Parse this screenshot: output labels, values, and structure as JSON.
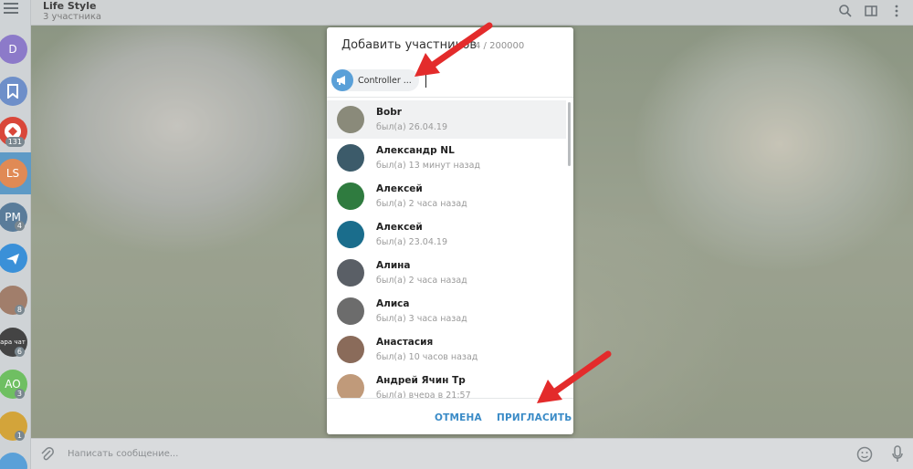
{
  "header": {
    "title": "Life Style",
    "subtitle": "3 участника"
  },
  "chats": [
    {
      "label": "D",
      "color": "#8c7ac9"
    },
    {
      "label": "",
      "color": "#6e8fc9",
      "icon": "bookmark-icon"
    },
    {
      "label": "",
      "color": "#d9473a",
      "badge": "131"
    },
    {
      "label": "LS",
      "color": "#e08a55"
    },
    {
      "label": "PM",
      "color": "#5a7c9a",
      "badge": "4"
    },
    {
      "label": "",
      "color": "#3a90d8",
      "icon": "plane-icon"
    },
    {
      "label": "",
      "color": "#a17e6b",
      "badge": "8"
    },
    {
      "label": "",
      "color": "#444444",
      "badge": "6",
      "text": "ара чат"
    },
    {
      "label": "AO",
      "color": "#6fbf62",
      "badge": "3"
    },
    {
      "label": "",
      "color": "#d3a43a",
      "badge": "1"
    }
  ],
  "modal": {
    "title": "Добавить участников",
    "count": "4 / 200000",
    "chip_label": "Controller ...",
    "contacts": [
      {
        "name": "Bobr",
        "status": "был(а) 26.04.19",
        "color": "#8a8a7a"
      },
      {
        "name": "Александр NL",
        "status": "был(а) 13 минут назад",
        "color": "#3c5b6a"
      },
      {
        "name": "Алексей",
        "status": "был(а) 2 часа назад",
        "color": "#2f7b3f"
      },
      {
        "name": "Алексей",
        "status": "был(а) 23.04.19",
        "color": "#1a6d8c"
      },
      {
        "name": "Алина",
        "status": "был(а) 2 часа назад",
        "color": "#5a5f66"
      },
      {
        "name": "Алиса",
        "status": "был(а) 3 часа назад",
        "color": "#6c6c6c"
      },
      {
        "name": "Анастасия",
        "status": "был(а) 10 часов назад",
        "color": "#8a6b5a"
      },
      {
        "name": "Андрей Ячин Тр",
        "status": "был(а) вчера в 21:57",
        "color": "#c09a7a"
      }
    ],
    "cancel_label": "ОТМЕНА",
    "invite_label": "ПРИГЛАСИТЬ"
  },
  "input": {
    "placeholder": "Написать сообщение..."
  },
  "colors": {
    "accent": "#3a8bc7",
    "annotation_arrow": "#e32b2b"
  }
}
